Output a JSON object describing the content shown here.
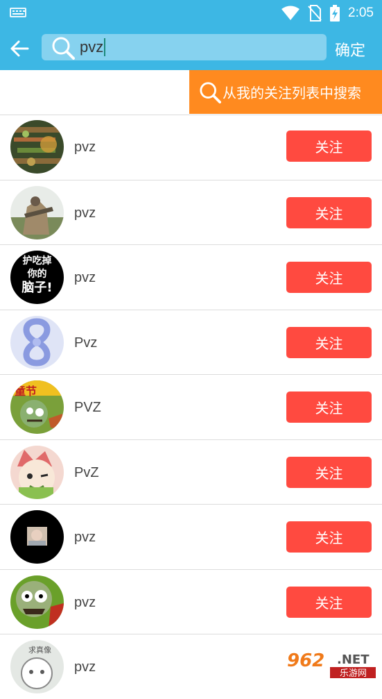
{
  "status_bar": {
    "time": "2:05",
    "icons": [
      "keyboard-icon",
      "wifi-icon",
      "no-sim-icon",
      "battery-charging-icon"
    ]
  },
  "toolbar": {
    "back_icon": "arrow-left-icon",
    "search_value": "pvz",
    "confirm_label": "确定"
  },
  "follow_search": {
    "label": "从我的关注列表中搜索",
    "icon": "search-icon"
  },
  "results": [
    {
      "name": "pvz",
      "button": "关注"
    },
    {
      "name": "pvz",
      "button": "关注"
    },
    {
      "name": "pvz",
      "button": "关注",
      "avatar_text": [
        "护吃掉",
        "你的",
        "脑子!"
      ]
    },
    {
      "name": "Pvz",
      "button": "关注"
    },
    {
      "name": "PVZ",
      "button": "关注",
      "avatar_text": [
        "童节"
      ]
    },
    {
      "name": "PvZ",
      "button": "关注"
    },
    {
      "name": "pvz",
      "button": "关注"
    },
    {
      "name": "pvz",
      "button": "关注"
    },
    {
      "name": "pvz",
      "button": "",
      "avatar_text": [
        "求真像"
      ]
    }
  ],
  "watermark": {
    "number": "962",
    "suffix": ".NET",
    "text": "乐游网"
  },
  "colors": {
    "accent": "#3DB7E4",
    "follow_button": "#FF4A40",
    "search_follow": "#FF8A1F"
  }
}
